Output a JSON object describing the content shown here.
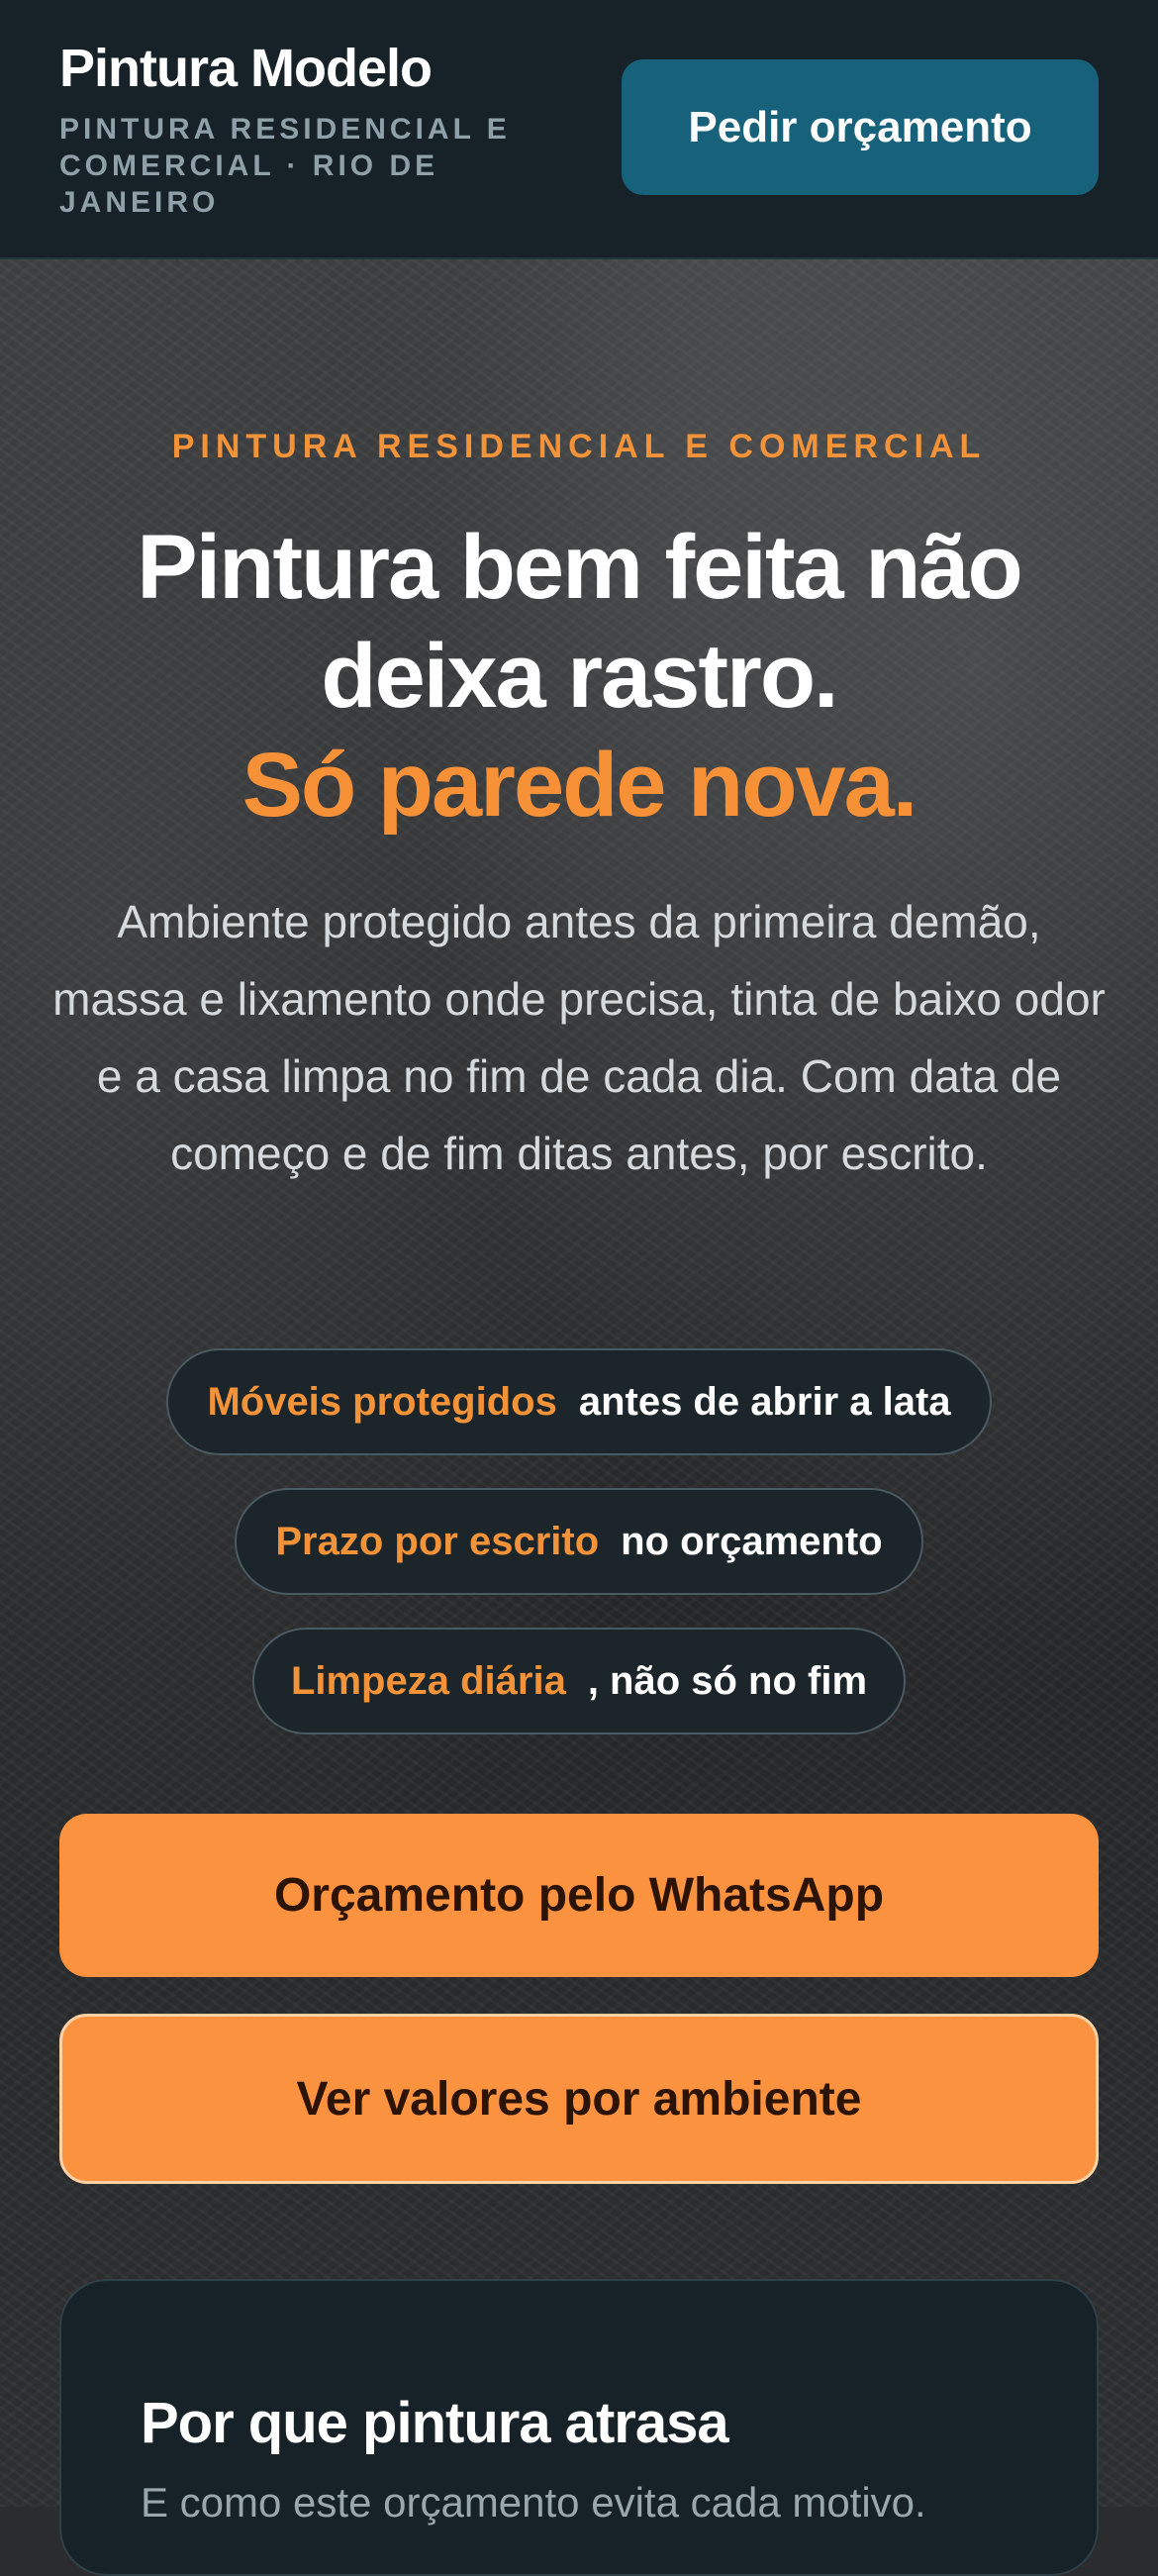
{
  "header": {
    "brand_name": "Pintura Modelo",
    "tagline": "PINTURA RESIDENCIAL E COMERCIAL · RIO DE JANEIRO",
    "cta_label": "Pedir orçamento"
  },
  "hero": {
    "eyebrow": "PINTURA RESIDENCIAL E COMERCIAL",
    "title_line1": "Pintura bem feita não deixa rastro.",
    "title_accent": "Só parede nova.",
    "description": "Ambiente protegido antes da primeira demão, massa e lixamento onde precisa, tinta de baixo odor e a casa limpa no fim de cada dia. Com data de começo e de fim ditas antes, por escrito."
  },
  "pills": [
    {
      "highlight": "Móveis protegidos",
      "rest": "antes de abrir a lata"
    },
    {
      "highlight": "Prazo por escrito",
      "rest": "no orçamento"
    },
    {
      "highlight": "Limpeza diária",
      "rest": ", não só no fim"
    }
  ],
  "actions": {
    "whatsapp_label": "Orçamento pelo WhatsApp",
    "valores_label": "Ver valores por ambiente"
  },
  "card": {
    "title": "Por que pintura atrasa",
    "subtitle": "E como este orçamento evita cada motivo."
  },
  "colors": {
    "accent": "#f79138",
    "header_bg": "#172228",
    "header_cta": "#17617a"
  }
}
